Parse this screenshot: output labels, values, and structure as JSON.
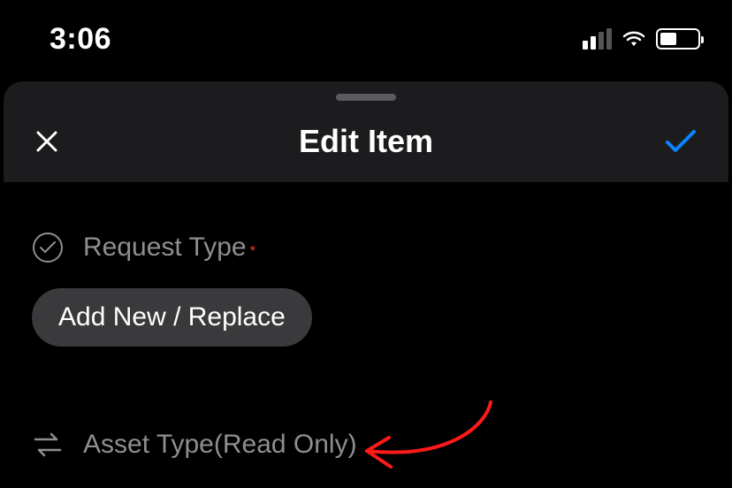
{
  "status": {
    "time": "3:06"
  },
  "sheet": {
    "title": "Edit Item"
  },
  "fields": {
    "requestType": {
      "label": "Request Type",
      "required": "*",
      "chip": "Add New / Replace"
    },
    "assetType": {
      "label": "Asset Type(Read Only)"
    }
  }
}
